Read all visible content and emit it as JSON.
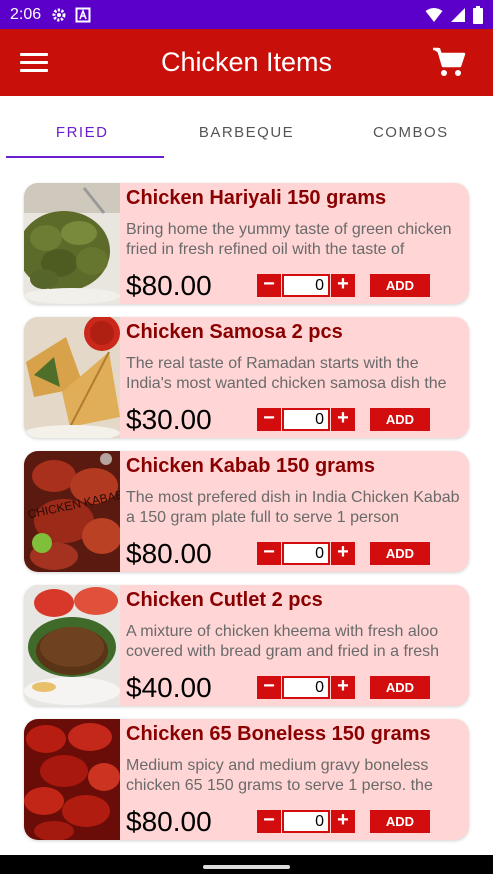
{
  "status_bar": {
    "time": "2:06"
  },
  "app_bar": {
    "title": "Chicken Items"
  },
  "tabs": [
    {
      "label": "FRIED"
    },
    {
      "label": "BARBEQUE"
    },
    {
      "label": "COMBOS"
    }
  ],
  "colors": {
    "status_bar": "#5a00c9",
    "app_bar": "#c80f0a",
    "card_bg": "#ffd5d5",
    "accent_tab": "#6a1fd0",
    "button": "#d30d0d",
    "item_title": "#8a0000"
  },
  "items": [
    {
      "name": "Chicken Hariyali 150 grams",
      "description": "Bring home the yummy taste of green chicken fried in fresh refined oil with the taste of",
      "price": "$80.00",
      "qty": "0",
      "minus": "−",
      "plus": "+",
      "add": "ADD"
    },
    {
      "name": "Chicken Samosa 2 pcs",
      "description": "The real taste of Ramadan starts with the India's most wanted chicken samosa dish the",
      "price": "$30.00",
      "qty": "0",
      "minus": "−",
      "plus": "+",
      "add": "ADD"
    },
    {
      "name": "Chicken Kabab 150 grams",
      "description": "The most prefered dish in India Chicken Kabab a 150 gram plate full to serve 1 person",
      "price": "$80.00",
      "qty": "0",
      "minus": "−",
      "plus": "+",
      "add": "ADD",
      "image_text": "CHICKEN KABAB"
    },
    {
      "name": "Chicken Cutlet 2 pcs",
      "description": "A mixture of chicken kheema with fresh aloo covered with bread gram and fried in a fresh",
      "price": "$40.00",
      "qty": "0",
      "minus": "−",
      "plus": "+",
      "add": "ADD"
    },
    {
      "name": "Chicken 65 Boneless 150 grams",
      "description": "Medium spicy and medium gravy boneless chicken 65 150 grams to serve 1 perso. the",
      "price": "$80.00",
      "qty": "0",
      "minus": "−",
      "plus": "+",
      "add": "ADD"
    }
  ]
}
